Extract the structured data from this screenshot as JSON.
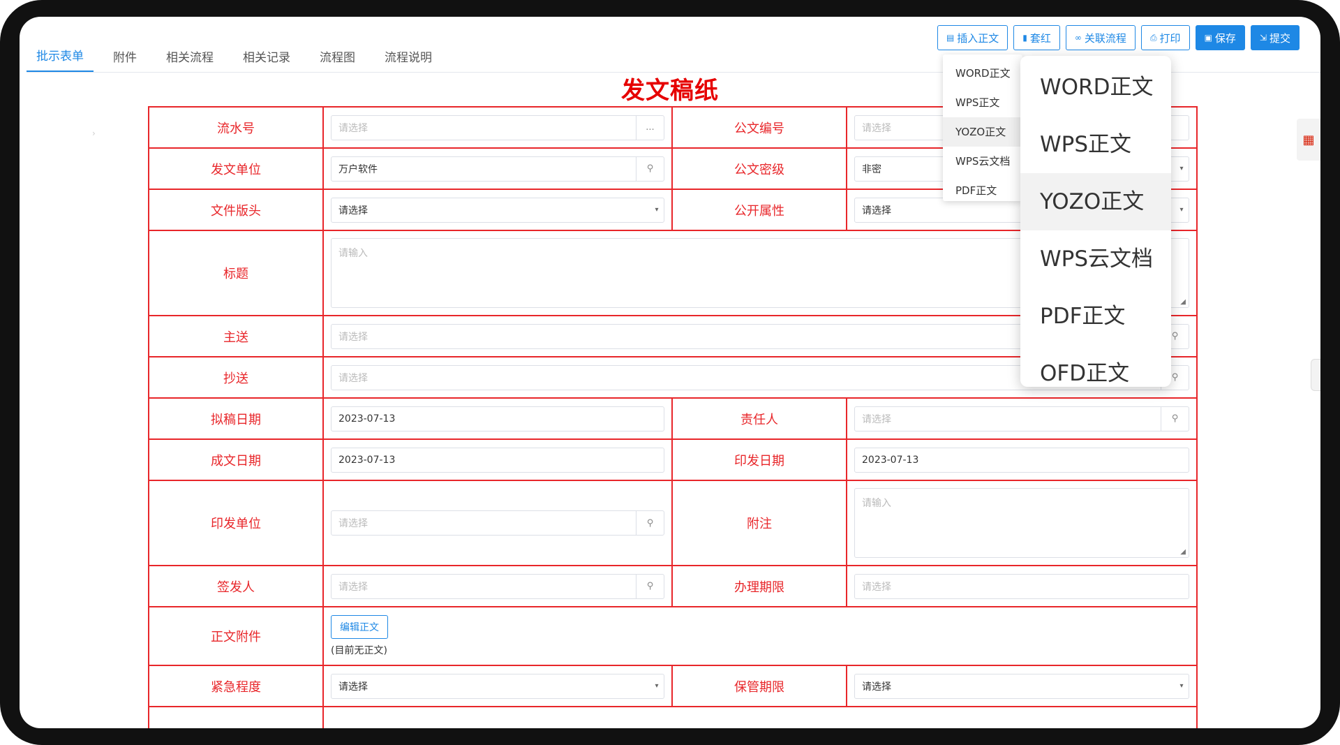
{
  "tabs": [
    "批示表单",
    "附件",
    "相关流程",
    "相关记录",
    "流程图",
    "流程说明"
  ],
  "toolbar": {
    "insert": "插入正文",
    "redhead": "套红",
    "link_flow": "关联流程",
    "print": "打印",
    "save": "保存",
    "submit": "提交"
  },
  "title": "发文稿纸",
  "fields": {
    "serial": {
      "label": "流水号",
      "placeholder": "请选择",
      "suffix": "..."
    },
    "doc_no": {
      "label": "公文编号",
      "placeholder": "请选择"
    },
    "issuer": {
      "label": "发文单位",
      "value": "万户软件"
    },
    "secret": {
      "label": "公文密级",
      "value": "非密"
    },
    "header": {
      "label": "文件版头",
      "value": "请选择"
    },
    "public": {
      "label": "公开属性",
      "value": "请选择"
    },
    "subject": {
      "label": "标题",
      "placeholder": "请输入"
    },
    "main_to": {
      "label": "主送",
      "placeholder": "请选择"
    },
    "cc": {
      "label": "抄送",
      "placeholder": "请选择"
    },
    "draft_date": {
      "label": "拟稿日期",
      "value": "2023-07-13"
    },
    "owner": {
      "label": "责任人",
      "placeholder": "请选择"
    },
    "done_date": {
      "label": "成文日期",
      "value": "2023-07-13"
    },
    "print_date": {
      "label": "印发日期",
      "value": "2023-07-13"
    },
    "print_unit": {
      "label": "印发单位",
      "placeholder": "请选择"
    },
    "remark": {
      "label": "附注",
      "placeholder": "请输入"
    },
    "signer": {
      "label": "签发人",
      "placeholder": "请选择"
    },
    "deadline": {
      "label": "办理期限",
      "placeholder": "请选择"
    },
    "attach": {
      "label": "正文附件",
      "button": "编辑正文",
      "note": "(目前无正文)"
    },
    "urgency": {
      "label": "紧急程度",
      "value": "请选择"
    },
    "retention": {
      "label": "保管期限",
      "value": "请选择"
    }
  },
  "menu_small": [
    "WORD正文",
    "WPS正文",
    "YOZO正文",
    "WPS云文档",
    "PDF正文"
  ],
  "menu_big": [
    "WORD正文",
    "WPS正文",
    "YOZO正文",
    "WPS云文档",
    "PDF正文",
    "OFD正文"
  ],
  "colors": {
    "accent": "#1e88e5",
    "red": "#e8262a",
    "title_red": "#e60000"
  }
}
